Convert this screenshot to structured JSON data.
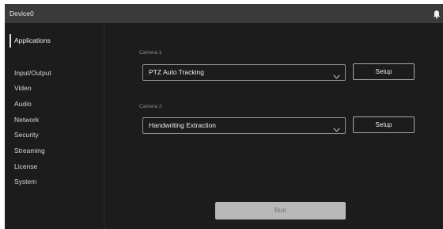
{
  "titlebar": {
    "device_name": "Device0",
    "bell_icon": "bell-icon"
  },
  "sidebar": {
    "items": [
      {
        "label": "Applications",
        "active": true
      },
      {
        "label": "Input/Output"
      },
      {
        "label": "Video"
      },
      {
        "label": "Audio"
      },
      {
        "label": "Network"
      },
      {
        "label": "Security"
      },
      {
        "label": "Streaming"
      },
      {
        "label": "License"
      },
      {
        "label": "System"
      }
    ]
  },
  "main": {
    "camera1": {
      "label": "Camera 1",
      "selected": "PTZ Auto Tracking",
      "setup_label": "Setup"
    },
    "camera2": {
      "label": "Camera 2",
      "selected": "Handwriting Extraction",
      "setup_label": "Setup"
    },
    "run_label": "Run"
  },
  "colors": {
    "background": "#1c1c1c",
    "titlebar": "#3a3a3a",
    "run_disabled": "#b8b8b8"
  }
}
